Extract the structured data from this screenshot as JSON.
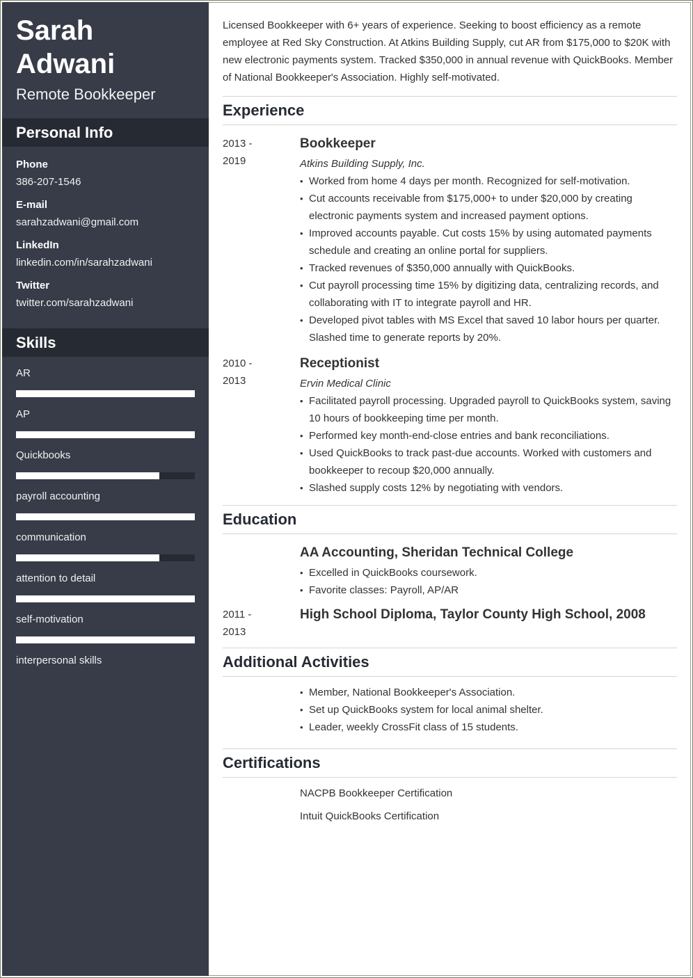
{
  "sidebar": {
    "name_line1": "Sarah",
    "name_line2": "Adwani",
    "job_title": "Remote Bookkeeper",
    "personal_info_title": "Personal Info",
    "contacts": [
      {
        "label": "Phone",
        "value": "386-207-1546"
      },
      {
        "label": "E-mail",
        "value": "sarahzadwani@gmail.com"
      },
      {
        "label": "LinkedIn",
        "value": "linkedin.com/in/sarahzadwani"
      },
      {
        "label": "Twitter",
        "value": "twitter.com/sarahzadwani"
      }
    ],
    "skills_title": "Skills",
    "skills": [
      {
        "name": "AR",
        "level": 1.0
      },
      {
        "name": "AP",
        "level": 1.0
      },
      {
        "name": "Quickbooks",
        "level": 0.8
      },
      {
        "name": "payroll accounting",
        "level": 1.0
      },
      {
        "name": "communication",
        "level": 0.8
      },
      {
        "name": "attention to detail",
        "level": 1.0
      },
      {
        "name": "self-motivation",
        "level": 1.0
      },
      {
        "name": "interpersonal skills",
        "level": null
      }
    ]
  },
  "colors": {
    "sidebar_bg": "#373c48",
    "sidebar_header_bg": "#262a33",
    "skill_fill": "#ffffff",
    "divider": "#d4d4d4"
  },
  "main": {
    "summary": "Licensed Bookkeeper with 6+ years of experience. Seeking to boost efficiency as a remote employee at Red Sky Construction. At Atkins Building Supply, cut AR from $175,000 to $20K with new electronic payments system. Tracked $350,000 in annual revenue with QuickBooks. Member of National Bookkeeper's Association. Highly self-motivated.",
    "experience_title": "Experience",
    "experience": [
      {
        "date_start": "2013 -",
        "date_end": "2019",
        "title": "Bookkeeper",
        "company": "Atkins Building Supply, Inc.",
        "bullets": [
          "Worked from home 4 days per month. Recognized for self-motivation.",
          "Cut accounts receivable from $175,000+ to under $20,000 by creating electronic payments system and increased payment options.",
          "Improved accounts payable. Cut costs 15% by using automated payments schedule and creating an online portal for suppliers.",
          "Tracked revenues of $350,000 annually with QuickBooks.",
          "Cut payroll processing time 15% by digitizing data, centralizing records, and collaborating with IT to integrate payroll and HR.",
          "Developed pivot tables with MS Excel that saved 10 labor hours per quarter. Slashed time to generate reports by 20%."
        ]
      },
      {
        "date_start": "2010 -",
        "date_end": "2013",
        "title": "Receptionist",
        "company": "Ervin Medical Clinic",
        "bullets": [
          "Facilitated payroll processing. Upgraded payroll to QuickBooks system, saving 10 hours of bookkeeping time per month.",
          "Performed key month-end-close entries and bank reconciliations.",
          "Used QuickBooks to track past-due accounts. Worked with customers and bookkeeper to recoup $20,000 annually.",
          "Slashed supply costs 12% by negotiating with vendors."
        ]
      }
    ],
    "education_title": "Education",
    "education": [
      {
        "date_start": "",
        "date_end": "",
        "title": "AA Accounting, Sheridan Technical College",
        "bullets": [
          "Excelled in QuickBooks coursework.",
          "Favorite classes: Payroll, AP/AR"
        ]
      },
      {
        "date_start": "2011 -",
        "date_end": "2013",
        "title": "High School Diploma, Taylor County High School, 2008",
        "bullets": []
      }
    ],
    "activities_title": "Additional Activities",
    "activities": [
      "Member, National Bookkeeper's Association.",
      "Set up QuickBooks system for local animal shelter.",
      "Leader, weekly CrossFit class of 15 students."
    ],
    "certifications_title": "Certifications",
    "certifications": [
      "NACPB Bookkeeper Certification",
      "Intuit QuickBooks Certification"
    ]
  }
}
